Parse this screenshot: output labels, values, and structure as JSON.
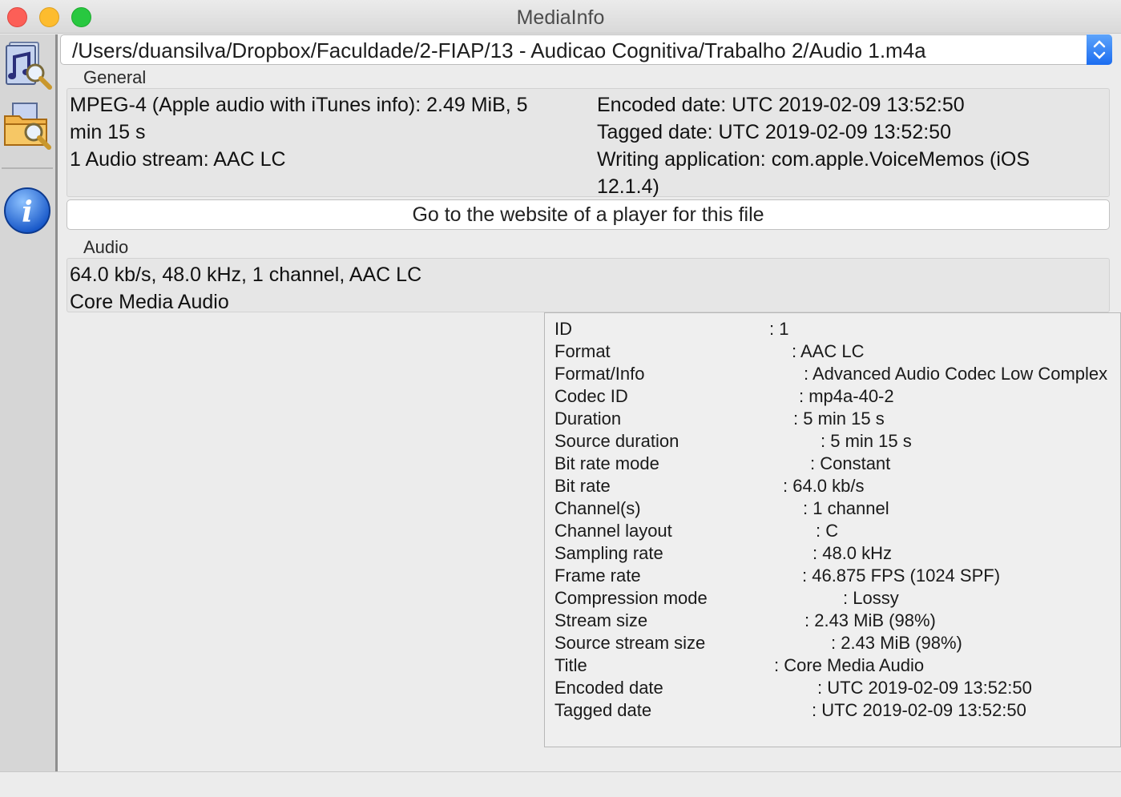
{
  "window": {
    "title": "MediaInfo"
  },
  "sidebar": {
    "buttons": [
      {
        "icon": "music-file-search-icon",
        "label": ""
      },
      {
        "icon": "folder-search-icon",
        "label": ""
      },
      {
        "icon": "info-icon",
        "label": "i"
      }
    ]
  },
  "file_selector": {
    "value": "/Users/duansilva/Dropbox/Faculdade/2-FIAP/13 - Audicao Cognitiva/Trabalho 2/Audio 1.m4a"
  },
  "general": {
    "label": "General",
    "left_lines": [
      "MPEG-4 (Apple audio with iTunes info): 2.49 MiB, 5",
      "min 15 s",
      "1 Audio stream: AAC LC"
    ],
    "right_lines": [
      "Encoded date: UTC 2019-02-09 13:52:50",
      "Tagged date: UTC 2019-02-09 13:52:50",
      "Writing application: com.apple.VoiceMemos (iOS",
      "12.1.4)"
    ]
  },
  "website_button": {
    "label": "Go to the website of a player for this file"
  },
  "audio": {
    "label": "Audio",
    "lines": [
      "64.0 kb/s, 48.0 kHz, 1 channel, AAC LC",
      "Core Media Audio"
    ]
  },
  "tooltip": {
    "rows": [
      {
        "key": "ID",
        "value": ": 1"
      },
      {
        "key": "Format",
        "value": ": AAC LC"
      },
      {
        "key": "Format/Info",
        "value": ": Advanced Audio Codec Low Complex"
      },
      {
        "key": "Codec ID",
        "value": ": mp4a-40-2"
      },
      {
        "key": "Duration",
        "value": ": 5 min 15 s"
      },
      {
        "key": "Source duration",
        "value": ": 5 min 15 s"
      },
      {
        "key": "Bit rate mode",
        "value": ": Constant"
      },
      {
        "key": "Bit rate",
        "value": ": 64.0 kb/s"
      },
      {
        "key": "Channel(s)",
        "value": ": 1 channel"
      },
      {
        "key": "Channel layout",
        "value": ": C"
      },
      {
        "key": "Sampling rate",
        "value": ": 48.0 kHz"
      },
      {
        "key": "Frame rate",
        "value": ": 46.875 FPS (1024 SPF)"
      },
      {
        "key": "Compression mode",
        "value": ": Lossy"
      },
      {
        "key": "Stream size",
        "value": ": 2.43 MiB (98%)"
      },
      {
        "key": "Source stream size",
        "value": ": 2.43 MiB (98%)"
      },
      {
        "key": "Title",
        "value": ": Core Media Audio"
      },
      {
        "key": "Encoded date",
        "value": ": UTC 2019-02-09 13:52:50"
      },
      {
        "key": "Tagged date",
        "value": ": UTC 2019-02-09 13:52:50"
      }
    ]
  }
}
